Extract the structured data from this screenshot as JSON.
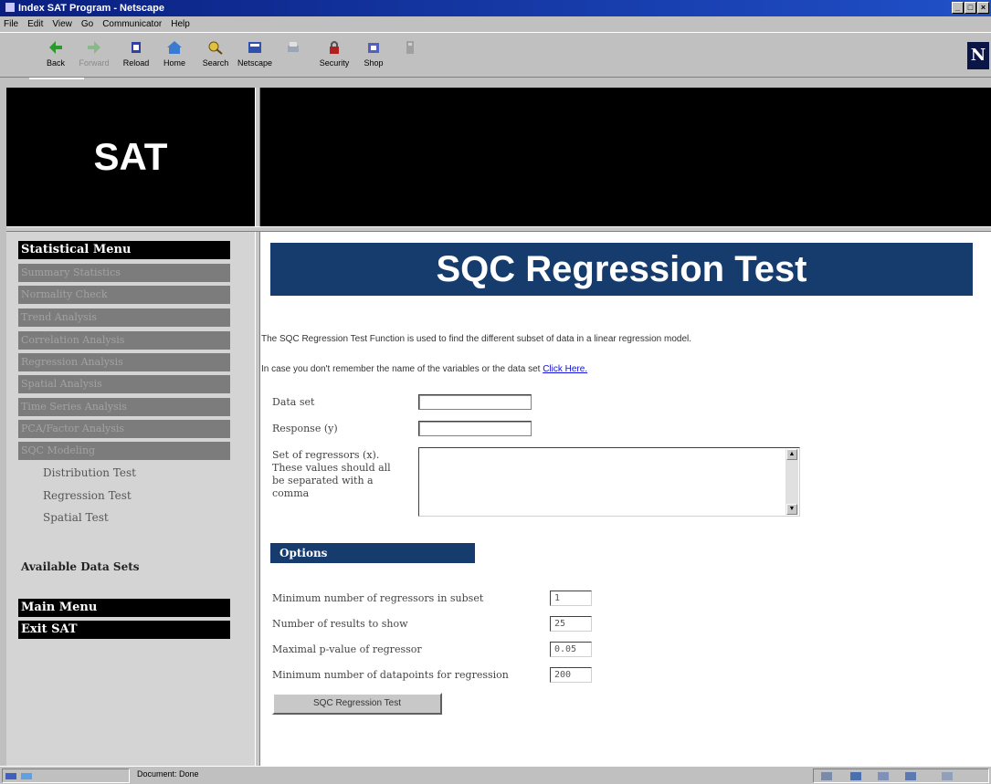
{
  "window": {
    "title": "Index SAT Program - Netscape"
  },
  "menubar": [
    "File",
    "Edit",
    "View",
    "Go",
    "Communicator",
    "Help"
  ],
  "toolbar": {
    "buttons": [
      {
        "label": "Back",
        "icon": "back-arrow-icon",
        "enabled": true
      },
      {
        "label": "Forward",
        "icon": "forward-arrow-icon",
        "enabled": false
      },
      {
        "label": "Reload",
        "icon": "reload-icon",
        "enabled": true
      },
      {
        "label": "Home",
        "icon": "home-icon",
        "enabled": true
      },
      {
        "label": "Search",
        "icon": "search-icon",
        "enabled": true
      },
      {
        "label": "Netscape",
        "icon": "netscape-icon",
        "enabled": true
      },
      {
        "label": "Print",
        "icon": "print-icon",
        "enabled": false
      },
      {
        "label": "Security",
        "icon": "lock-icon",
        "enabled": true
      },
      {
        "label": "Shop",
        "icon": "shop-icon",
        "enabled": true
      },
      {
        "label": "Stop",
        "icon": "stop-icon",
        "enabled": false
      }
    ],
    "logo": "N"
  },
  "banner": {
    "text": "SAT"
  },
  "sidebar": {
    "statistical_header": "Statistical Menu",
    "items": [
      "Summary Statistics",
      "Normality Check",
      "Trend Analysis",
      "Correlation Analysis",
      "Regression Analysis",
      "Spatial Analysis",
      "Time Series Analysis",
      "PCA/Factor Analysis",
      "SQC Modeling"
    ],
    "sub_items": [
      "Distribution Test",
      "Regression Test",
      "Spatial Test"
    ],
    "available_data_sets": "Available Data Sets",
    "main_menu": "Main Menu",
    "exit": "Exit SAT"
  },
  "main": {
    "title": "SQC Regression Test",
    "description": "The SQC Regression Test Function is used to find the different subset of data in a linear regression model.",
    "reminder_prefix": "In case you don't remember the name of the variables or the data set",
    "reminder_link": "Click Here.",
    "fields": {
      "data_set_label": "Data set",
      "response_label": "Response (y)",
      "regressors_label_lines": [
        "Set of regressors (x).",
        "These values should all",
        "be separated with a",
        "comma"
      ]
    },
    "options": {
      "header": "Options",
      "rows": [
        {
          "label": "Minimum number of regressors in subset",
          "value": "1"
        },
        {
          "label": "Number of results to show",
          "value": "25"
        },
        {
          "label": "Maximal p-value of regressor",
          "value": "0.05"
        },
        {
          "label": "Minimum number of datapoints for regression",
          "value": "200"
        }
      ]
    },
    "submit_label": "SQC Regression Test"
  },
  "statusbar": {
    "text": "Document: Done"
  }
}
